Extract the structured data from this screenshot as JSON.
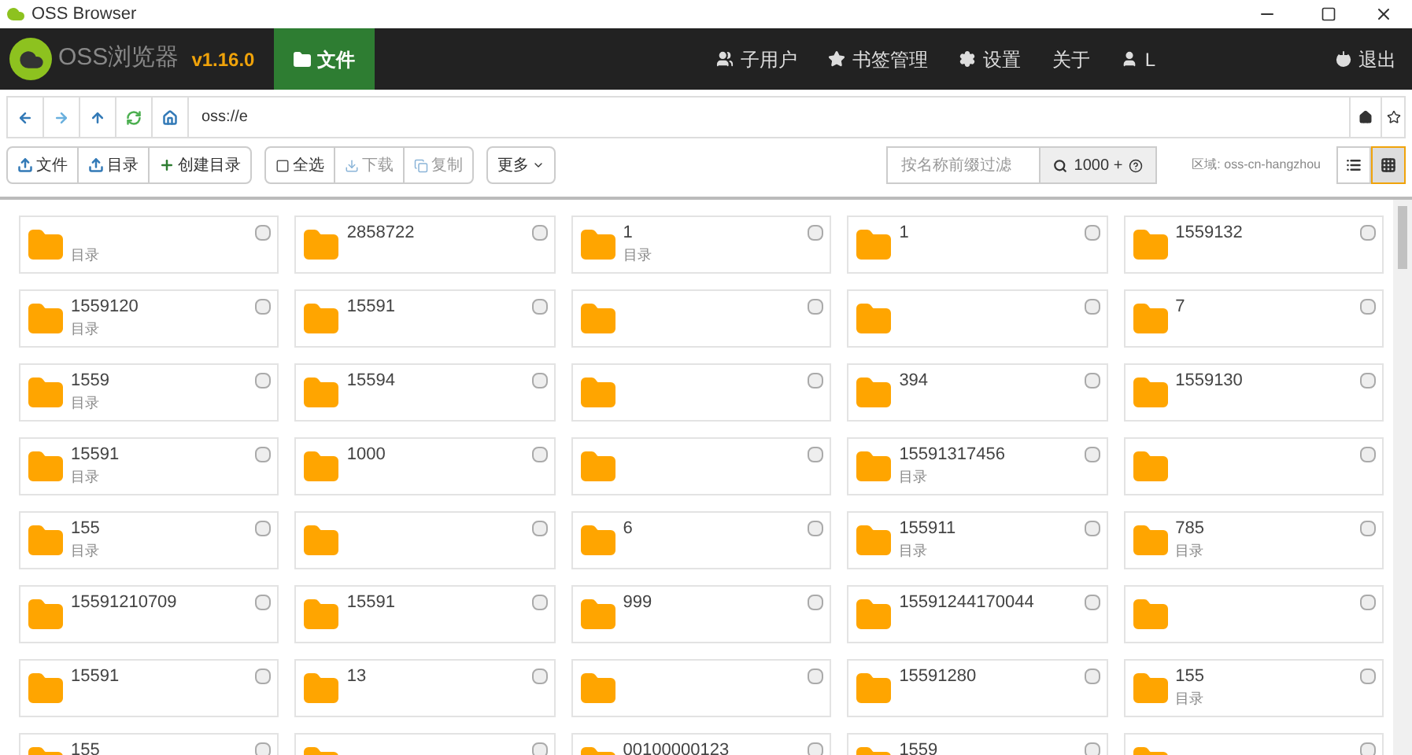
{
  "window": {
    "title": "OSS Browser"
  },
  "header": {
    "app_name": "OSS浏览器",
    "version": "v1.16.0",
    "tabs": [
      {
        "label": "文件",
        "selected": true
      }
    ],
    "menu": [
      {
        "label": "子用户"
      },
      {
        "label": "书签管理"
      },
      {
        "label": "设置"
      },
      {
        "label": "关于"
      },
      {
        "label": "L"
      },
      {
        "label": "退出"
      }
    ]
  },
  "address": {
    "value": "oss://e"
  },
  "toolbar": {
    "left": [
      {
        "label": "文件"
      },
      {
        "label": "目录"
      },
      {
        "label": "创建目录"
      }
    ],
    "middle": [
      {
        "label": "全选",
        "disabled": false
      },
      {
        "label": "下载",
        "disabled": true
      },
      {
        "label": "复制",
        "disabled": true
      }
    ],
    "more": "更多",
    "filter": {
      "placeholder": "按名称前缀过滤"
    },
    "search_label": "1000 +",
    "region": "区域: oss-cn-hangzhou",
    "views": [
      {
        "selected": false
      },
      {
        "selected": true
      }
    ]
  },
  "grid": [
    {
      "sub": "目录",
      "checked": false
    },
    {
      "name": "2858722",
      "checked": false
    },
    {
      "name": "1",
      "sub": "目录",
      "checked": false
    },
    {
      "name": "1",
      "checked": false
    },
    {
      "name": "1559132",
      "checked": false
    },
    {
      "name": "1559120",
      "sub": "目录",
      "checked": false
    },
    {
      "name": "15591",
      "checked": false
    },
    {
      "checked": false
    },
    {
      "checked": false
    },
    {
      "name": "7",
      "checked": false
    },
    {
      "name": "1559",
      "sub": "目录",
      "checked": false
    },
    {
      "name": "15594",
      "checked": false
    },
    {
      "checked": false
    },
    {
      "name": "394",
      "checked": false
    },
    {
      "name": "1559130",
      "checked": false
    },
    {
      "name": "15591",
      "sub": "目录",
      "checked": false
    },
    {
      "name": "1000",
      "checked": false
    },
    {
      "checked": false
    },
    {
      "name": "15591317456",
      "sub": "目录",
      "checked": false
    },
    {
      "checked": false
    },
    {
      "name": "155",
      "sub": "目录",
      "checked": false
    },
    {
      "checked": false
    },
    {
      "name": "6",
      "checked": false
    },
    {
      "name": "155911",
      "sub": "目录",
      "checked": false
    },
    {
      "name": "785",
      "sub": "目录",
      "checked": false
    },
    {
      "name": "15591210709",
      "checked": false
    },
    {
      "name": "15591",
      "checked": false
    },
    {
      "name": "999",
      "checked": false
    },
    {
      "name": "15591244170044",
      "checked": false
    },
    {
      "checked": false
    },
    {
      "name": "15591",
      "checked": false
    },
    {
      "name": "13",
      "checked": false
    },
    {
      "checked": false
    },
    {
      "name": "15591280",
      "checked": false
    },
    {
      "name": "155",
      "sub": "目录",
      "checked": false
    },
    {
      "name": "155",
      "checked": false
    },
    {
      "checked": false
    },
    {
      "name": "00100000123",
      "checked": false
    },
    {
      "name": "1559",
      "checked": false
    },
    {
      "checked": false
    }
  ]
}
